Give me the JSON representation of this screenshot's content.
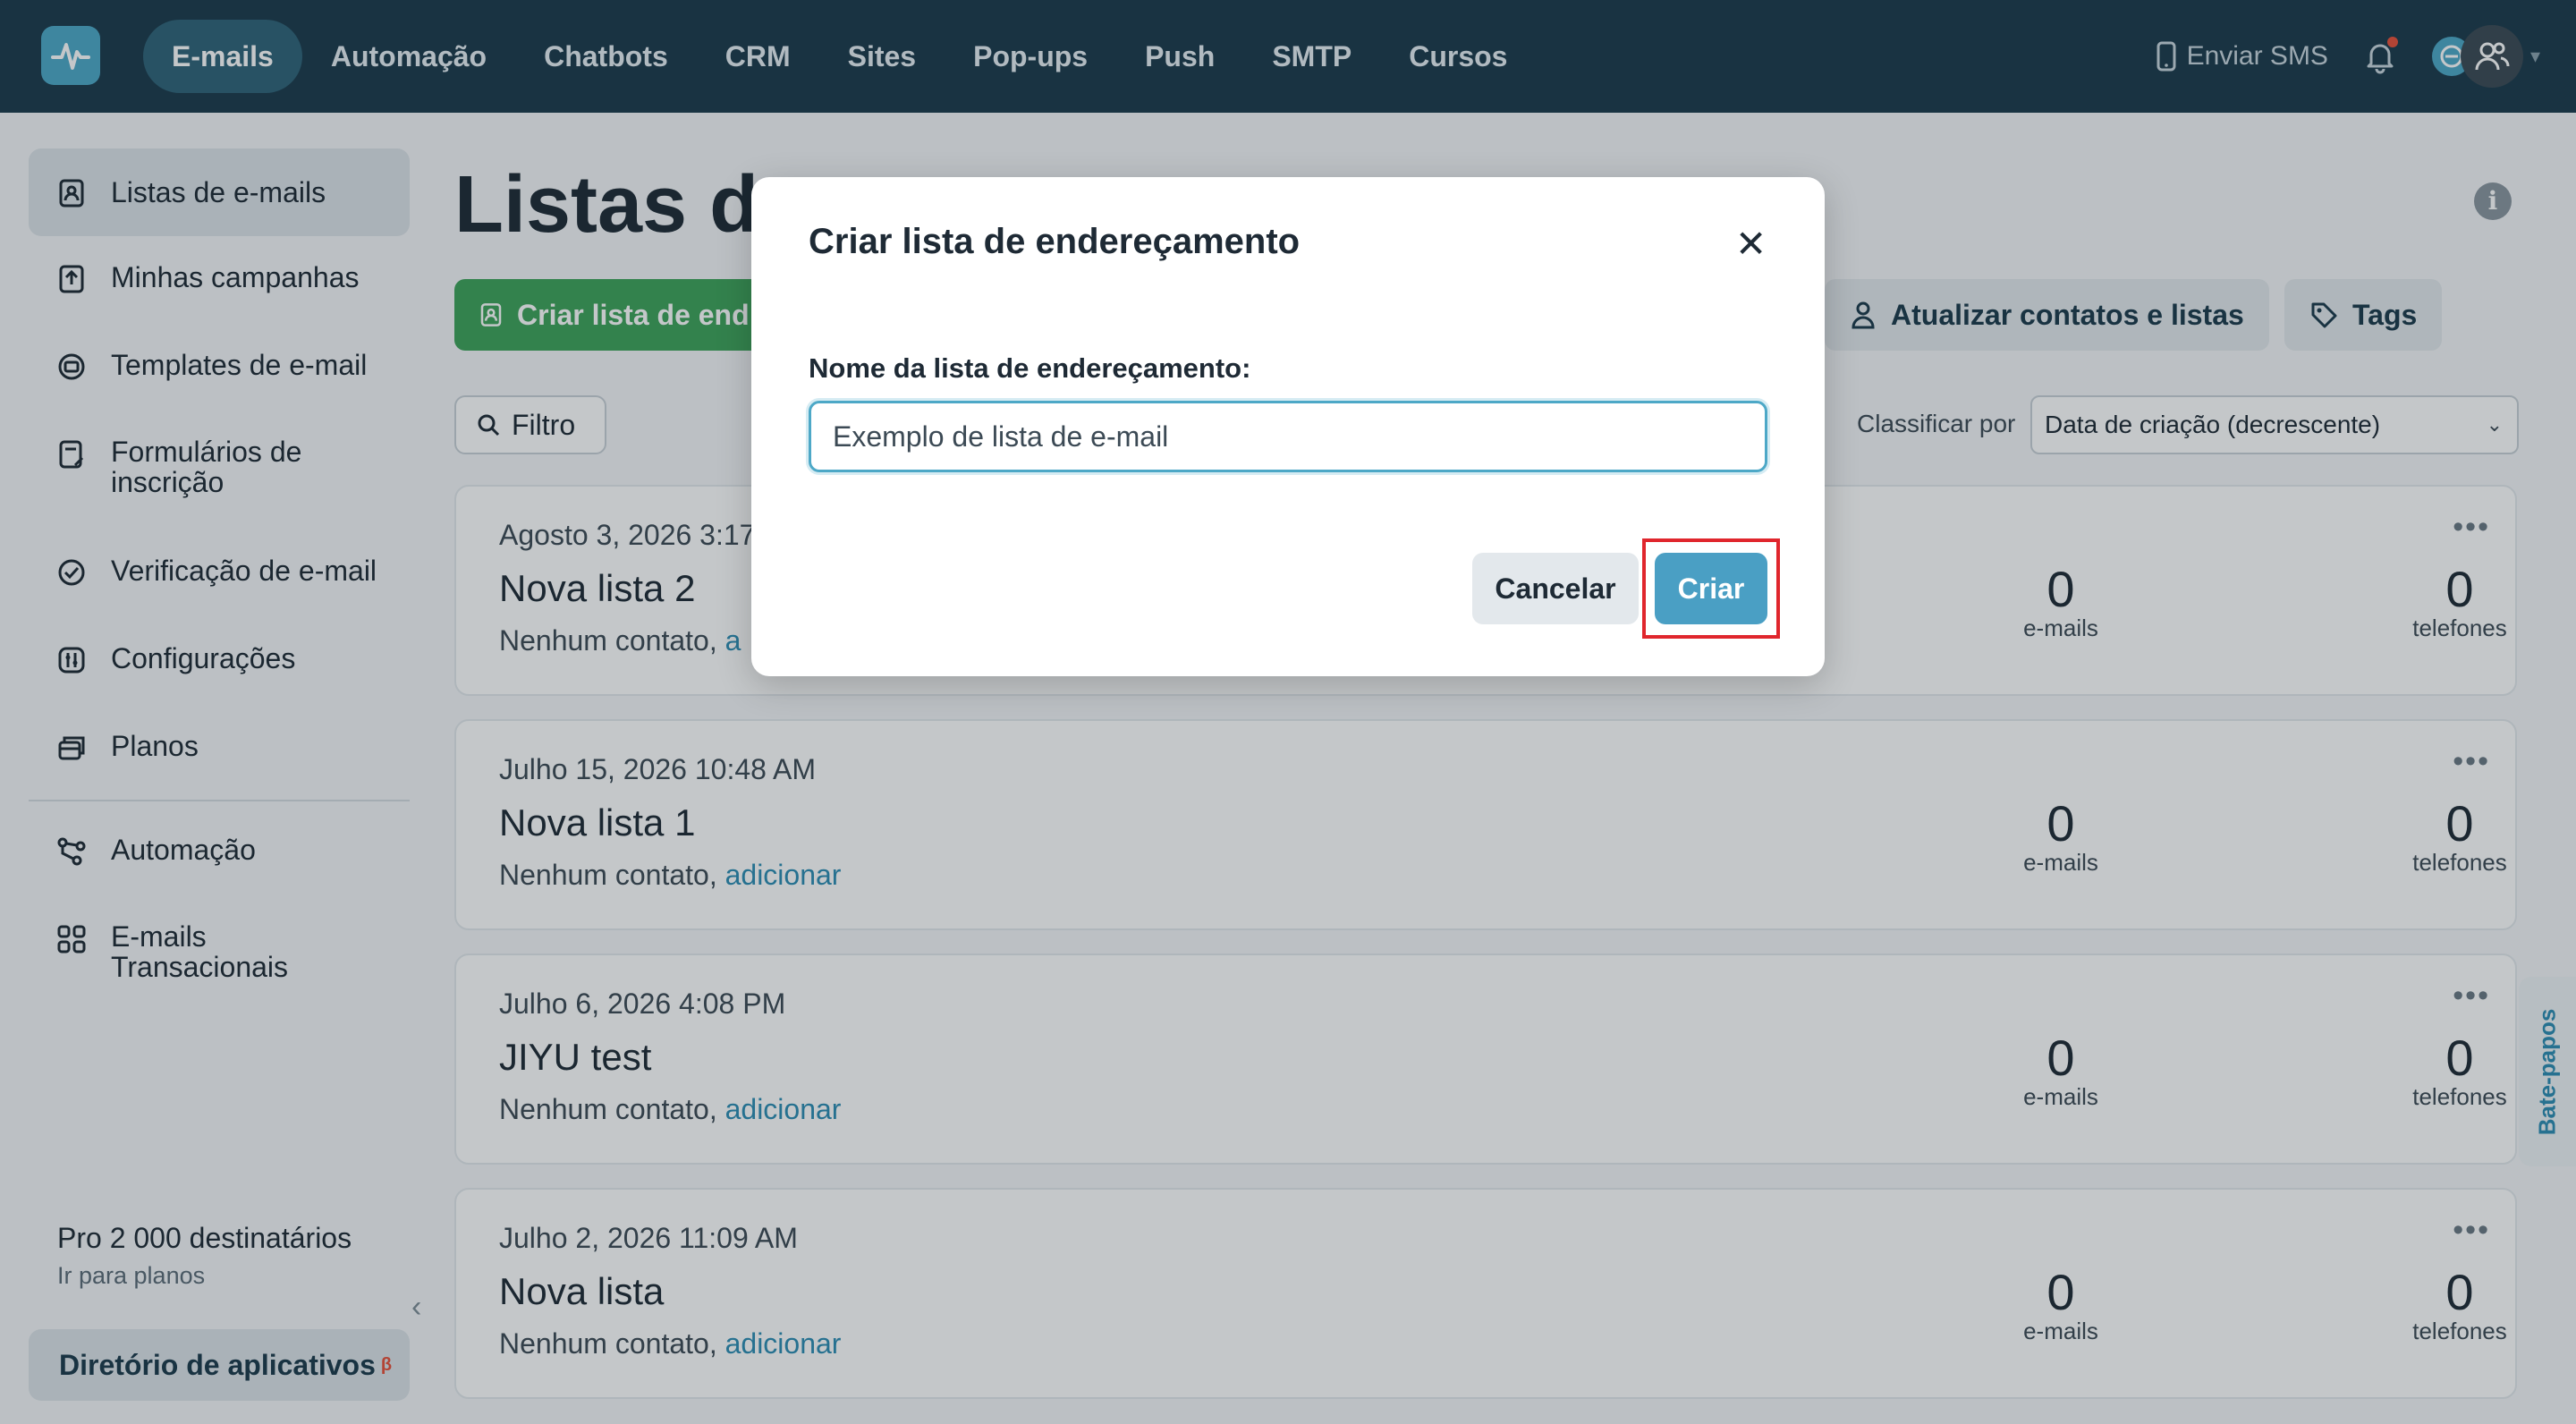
{
  "nav": {
    "items": [
      "E-mails",
      "Automação",
      "Chatbots",
      "CRM",
      "Sites",
      "Pop-ups",
      "Push",
      "SMTP",
      "Cursos"
    ],
    "active": "E-mails",
    "send_sms": "Enviar SMS"
  },
  "sidebar": {
    "items": [
      {
        "label": "Listas de e-mails",
        "icon": "contact-list-icon"
      },
      {
        "label": "Minhas campanhas",
        "icon": "campaign-icon"
      },
      {
        "label": "Templates de e-mail",
        "icon": "template-icon"
      },
      {
        "label": "Formulários de inscrição",
        "icon": "form-icon"
      },
      {
        "label": "Verificação de e-mail",
        "icon": "check-circle-icon"
      },
      {
        "label": "Configurações",
        "icon": "settings-icon"
      },
      {
        "label": "Planos",
        "icon": "plans-icon"
      },
      {
        "label": "Automação",
        "icon": "automation-icon"
      },
      {
        "label": "E-mails Transacionais",
        "icon": "grid-icon"
      }
    ],
    "plan_title": "Pro 2 000 destinatários",
    "plan_link": "Ir para planos",
    "app_directory": "Diretório de aplicativos",
    "app_directory_badge": "β"
  },
  "main": {
    "title": "Listas de",
    "create_button": "Criar lista de end",
    "update_contacts_button": "Atualizar contatos e listas",
    "tags_button": "Tags",
    "filter_button": "Filtro",
    "sort_label": "Classificar por",
    "sort_value": "Data de criação (decrescente)",
    "emails_label": "e-mails",
    "phones_label": "telefones",
    "no_contacts": "Nenhum contato,",
    "add_link": "adicionar",
    "lists": [
      {
        "date": "Agosto 3, 2026 3:17",
        "name": "Nova lista 2",
        "emails": "0",
        "phones": "0",
        "add": "a"
      },
      {
        "date": "Julho 15, 2026 10:48 AM",
        "name": "Nova lista 1",
        "emails": "0",
        "phones": "0",
        "add": "adicionar"
      },
      {
        "date": "Julho 6, 2026 4:08 PM",
        "name": "JIYU test",
        "emails": "0",
        "phones": "0",
        "add": "adicionar"
      },
      {
        "date": "Julho 2, 2026 11:09 AM",
        "name": "Nova lista",
        "emails": "0",
        "phones": "0",
        "add": "adicionar"
      }
    ]
  },
  "chat_tab": "Bate-papos",
  "modal": {
    "title": "Criar lista de endereçamento",
    "field_label": "Nome da lista de endereçamento:",
    "field_value": "Exemplo de lista de e-mail",
    "cancel": "Cancelar",
    "create": "Criar"
  },
  "colors": {
    "topbar": "#1b3a4b",
    "accent": "#4a9fc4",
    "green": "#3ea35a",
    "highlight": "#e0262d"
  }
}
